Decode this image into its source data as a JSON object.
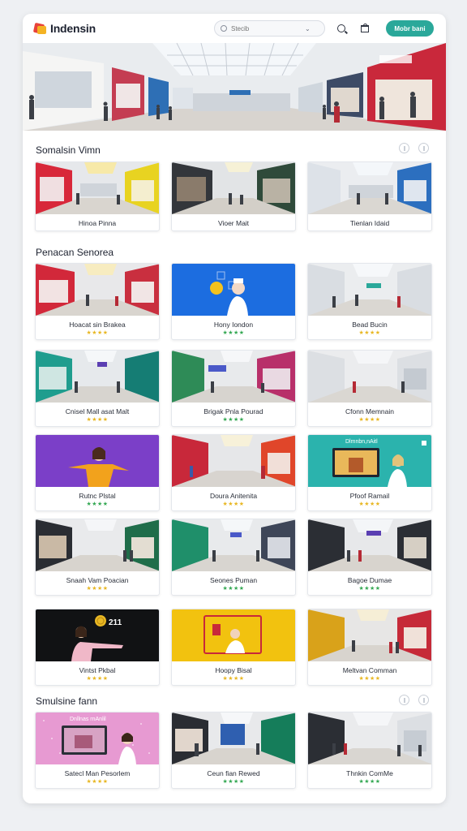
{
  "app": {
    "brand": "Indensin",
    "search_placeholder": "Stecib",
    "cta_label": "Mobr bani"
  },
  "icons": {
    "search": "search-icon",
    "bag": "shopping-bag-icon",
    "chevron": "chevron-down-icon",
    "info": "info-icon",
    "settings": "settings-icon"
  },
  "colors": {
    "accent": "#2aa89a",
    "star": "#e8b723",
    "star_green": "#34a853"
  },
  "sections": [
    {
      "title": "Somalsin Vimn",
      "cards": [
        {
          "label": "Hinoa Pinna",
          "stars": null
        },
        {
          "label": "Vioer Mait",
          "stars": null
        },
        {
          "label": "Tienlan Idaid",
          "stars": null
        }
      ]
    },
    {
      "title": "Penacan Senorea",
      "cards": [
        {
          "label": "Hoacat sin Brakea",
          "stars": "★★★★"
        },
        {
          "label": "Hony Iondon",
          "stars": "★★★★"
        },
        {
          "label": "Bead Bucin",
          "stars": "★★★★"
        },
        {
          "label": "Cnisel Mall asat Malt",
          "stars": "★★★★"
        },
        {
          "label": "Brigak Pnla Pourad",
          "stars": "★★★★"
        },
        {
          "label": "Cfonn Memnain",
          "stars": "★★★★"
        },
        {
          "label": "Rutnc Plstal",
          "stars": "★★★★"
        },
        {
          "label": "Doura Anitenita",
          "stars": "★★★★"
        },
        {
          "label": "Pfoof Ramail",
          "stars": "★★★★"
        },
        {
          "label": "Snaah Vam Poacian",
          "stars": "★★★★"
        },
        {
          "label": "Seones Puman",
          "stars": "★★★★"
        },
        {
          "label": "Bagoe Dumae",
          "stars": "★★★★"
        },
        {
          "label": "Vintst Pkbal",
          "stars": "★★★★"
        },
        {
          "label": "Hoopy Bisal",
          "stars": "★★★★"
        },
        {
          "label": "Meltvan Comman",
          "stars": "★★★★"
        }
      ]
    },
    {
      "title": "Smulsine fann",
      "cards": [
        {
          "label": "Satecl Man Pesorlem",
          "stars": "★★★★"
        },
        {
          "label": "Ceun fian Rewed",
          "stars": "★★★★"
        },
        {
          "label": "Thnkin ComMe",
          "stars": "★★★★"
        }
      ]
    }
  ],
  "overlay_texts": {
    "card_tv_banner": "Dlmnbn,nAitl",
    "card_coin_value": "211",
    "card_pink_banner": "Dnllnas rnAnlil"
  }
}
